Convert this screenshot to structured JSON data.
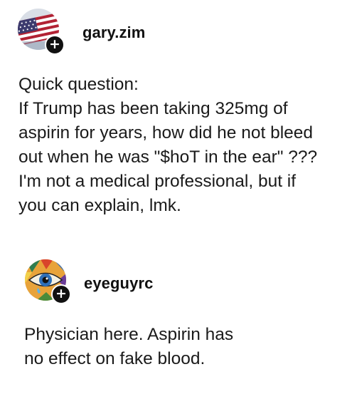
{
  "posts": [
    {
      "username": "gary.zim",
      "avatar_icon": "us-flag-avatar",
      "follow_icon": "plus-icon",
      "follow_label": "+",
      "text": "Quick question:\nIf Trump has been taking 325mg of\naspirin for years, how did he not bleed\nout when he was \"$hoT in the ear\" ???\nI'm not a medical professional, but if\nyou can explain, lmk."
    },
    {
      "username": "eyeguyrc",
      "avatar_icon": "mosaic-eye-avatar",
      "follow_icon": "plus-icon",
      "follow_label": "+",
      "text": "Physician here. Aspirin has\nno effect on fake blood."
    }
  ],
  "colors": {
    "text": "#1a1a1a",
    "badge": "#111111",
    "flag_red": "#b22234",
    "flag_blue": "#3c3b6e"
  }
}
